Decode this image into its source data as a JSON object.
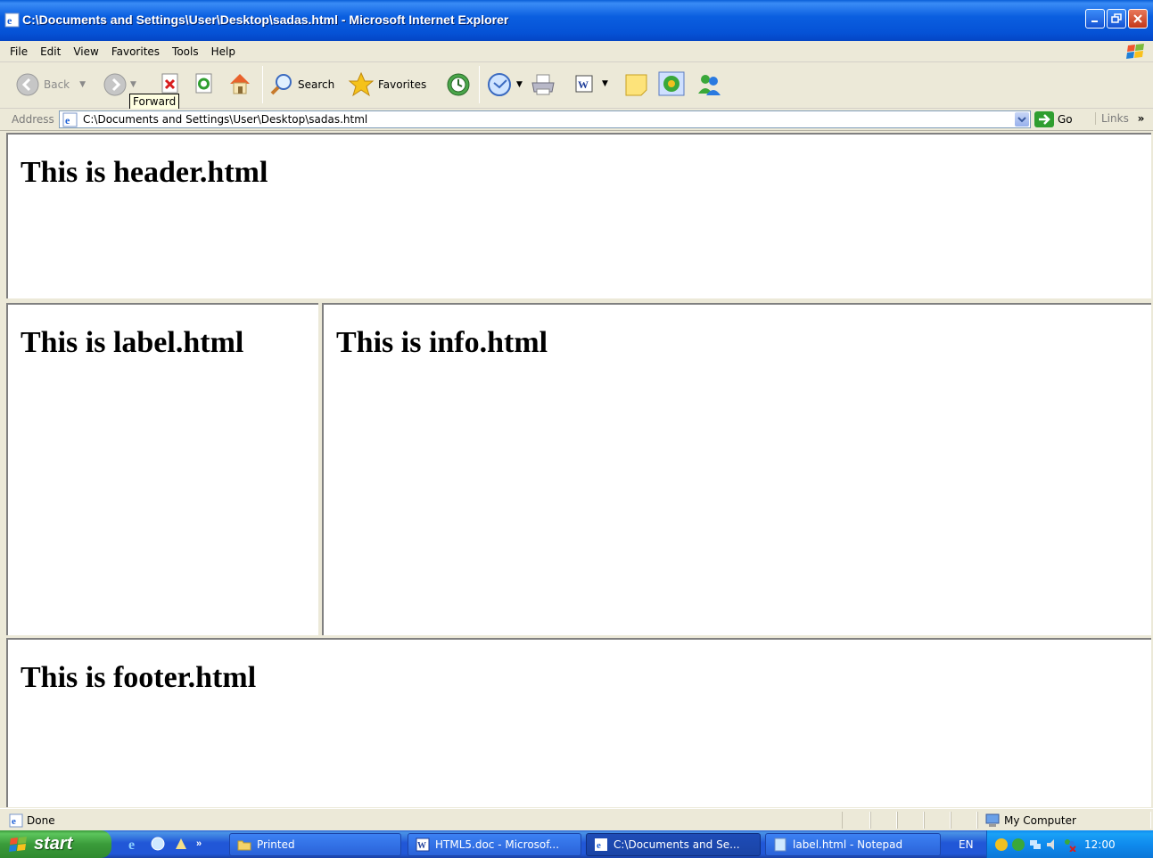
{
  "window": {
    "title": "C:\\Documents and Settings\\User\\Desktop\\sadas.html - Microsoft Internet Explorer"
  },
  "menu": {
    "items": [
      {
        "label": "File"
      },
      {
        "label": "Edit"
      },
      {
        "label": "View"
      },
      {
        "label": "Favorites"
      },
      {
        "label": "Tools"
      },
      {
        "label": "Help"
      }
    ]
  },
  "toolbar": {
    "back_label": "Back",
    "search_label": "Search",
    "favorites_label": "Favorites",
    "tooltip": "Forward"
  },
  "address": {
    "label": "Address",
    "value": "C:\\Documents and Settings\\User\\Desktop\\sadas.html",
    "go_label": "Go",
    "links_label": "Links"
  },
  "frames": {
    "header": "This is header.html",
    "label": "This is label.html",
    "info": "This is info.html",
    "footer": "This is footer.html"
  },
  "status": {
    "text": "Done",
    "zone": "My Computer"
  },
  "taskbar": {
    "start_label": "start",
    "tasks": [
      {
        "label": "Printed"
      },
      {
        "label": "HTML5.doc - Microsof..."
      },
      {
        "label": "C:\\Documents and Se..."
      },
      {
        "label": "label.html - Notepad"
      }
    ],
    "language": "EN",
    "clock": "12:00"
  }
}
